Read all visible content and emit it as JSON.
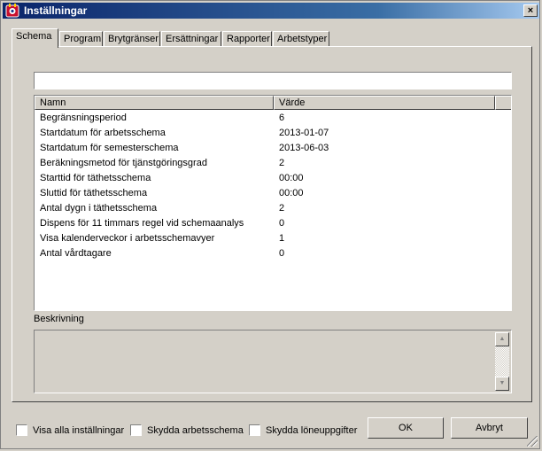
{
  "window": {
    "title": "Inställningar",
    "close_label": "×"
  },
  "tabs": [
    {
      "label": "Schema",
      "active": true
    },
    {
      "label": "Program"
    },
    {
      "label": "Brytgränser"
    },
    {
      "label": "Ersättningar"
    },
    {
      "label": "Rapporter"
    },
    {
      "label": "Arbetstyper"
    }
  ],
  "search": {
    "value": "",
    "placeholder": ""
  },
  "table": {
    "columns": [
      "Namn",
      "Värde"
    ],
    "rows": [
      {
        "name": "Begränsningsperiod",
        "value": "6"
      },
      {
        "name": "Startdatum för arbetsschema",
        "value": "2013-01-07"
      },
      {
        "name": "Startdatum för semesterschema",
        "value": "2013-06-03"
      },
      {
        "name": "Beräkningsmetod för tjänstgöringsgrad",
        "value": "2"
      },
      {
        "name": "Starttid för täthetsschema",
        "value": "00:00"
      },
      {
        "name": "Sluttid för täthetsschema",
        "value": "00:00"
      },
      {
        "name": "Antal dygn i täthetsschema",
        "value": "2"
      },
      {
        "name": "Dispens för 11 timmars regel vid schemaanalys",
        "value": "0"
      },
      {
        "name": "Visa kalenderveckor i arbetsschemavyer",
        "value": "1"
      },
      {
        "name": "Antal vårdtagare",
        "value": "0"
      }
    ]
  },
  "description": {
    "label": "Beskrivning",
    "scroll_up": "▲",
    "scroll_down": "▼"
  },
  "footer": {
    "checkboxes": [
      {
        "label": "Visa alla inställningar",
        "checked": false
      },
      {
        "label": "Skydda arbetsschema",
        "checked": false
      },
      {
        "label": "Skydda löneuppgifter",
        "checked": false
      }
    ],
    "ok_label": "OK",
    "cancel_label": "Avbryt"
  },
  "colors": {
    "titlebar_start": "#0a246a",
    "titlebar_end": "#a6caf0",
    "face": "#d4d0c8"
  },
  "icons": {
    "app": "app-icon",
    "close": "close-icon",
    "grip": "resize-grip-icon"
  }
}
